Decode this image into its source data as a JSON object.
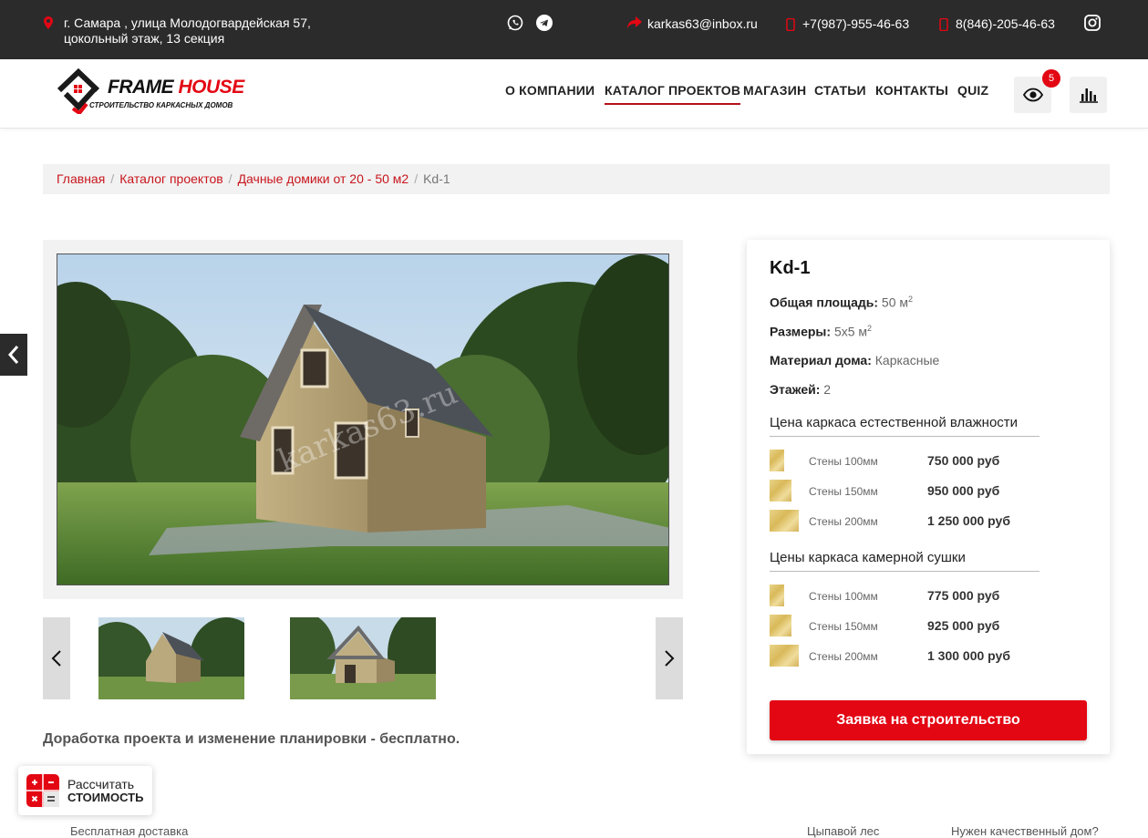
{
  "topbar": {
    "address_line1": "г. Самара , улица Молодогвардейская 57,",
    "address_line2": "цокольный этаж, 13 секция",
    "email": "karkas63@inbox.ru",
    "phone1": "+7(987)-955-46-63",
    "phone2": "8(846)-205-46-63"
  },
  "logo": {
    "brand1": "FRAME",
    "brand2": "HOUSE",
    "tagline": "СТРОИТЕЛЬСТВО КАРКАСНЫХ ДОМОВ"
  },
  "nav": [
    "О КОМПАНИИ",
    "КАТАЛОГ ПРОЕКТОВ",
    "МАГАЗИН",
    "СТАТЬИ",
    "КОНТАКТЫ",
    "QUIZ"
  ],
  "nav_active_index": 1,
  "viewed_count": "5",
  "breadcrumbs": [
    "Главная",
    "Каталог проектов",
    "Дачные домики от 20 - 50 м2",
    "Kd-1"
  ],
  "watermark": "karkas63.ru",
  "note": "Доработка проекта и изменение планировки - бесплатно.",
  "card": {
    "title": "Kd-1",
    "props": [
      {
        "label": "Общая площадь:",
        "value": "50 м",
        "sup": "2"
      },
      {
        "label": "Размеры:",
        "value": "5x5 м",
        "sup": "2"
      },
      {
        "label": "Материал дома:",
        "value": "Каркасные",
        "sup": ""
      },
      {
        "label": "Этажей:",
        "value": "2",
        "sup": ""
      }
    ],
    "section1": "Цена каркаса естественной влажности",
    "prices1": [
      {
        "label": "Стены 100мм",
        "price": "750 000 руб"
      },
      {
        "label": "Стены 150мм",
        "price": "950 000 руб"
      },
      {
        "label": "Стены 200мм",
        "price": "1 250 000 руб"
      }
    ],
    "section2": "Цены каркаса камерной сушки",
    "prices2": [
      {
        "label": "Стены 100мм",
        "price": "775 000 руб"
      },
      {
        "label": "Стены 150мм",
        "price": "925 000 руб"
      },
      {
        "label": "Стены 200мм",
        "price": "1 300 000 руб"
      }
    ],
    "cta": "Заявка на строительство"
  },
  "calc": {
    "line1": "Рассчитать",
    "line2": "СТОИМОСТЬ"
  },
  "footer_peek": [
    "Бесплатная доставка",
    "Цыпавой лес",
    "Нужен качественный дом?"
  ],
  "colors": {
    "accent": "#e30613",
    "topbar": "#2b2b2b",
    "link": "#c8161d"
  }
}
